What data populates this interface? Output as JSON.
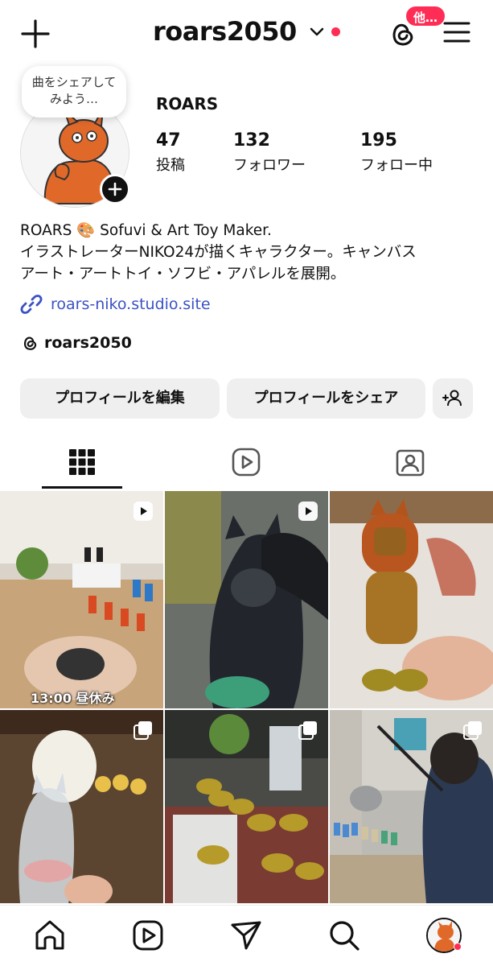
{
  "header": {
    "username": "roars2050",
    "threads_badge": "他…"
  },
  "profile": {
    "note": "曲をシェアしてみよう…",
    "display_name": "ROARS",
    "stats": [
      {
        "value": "47",
        "label": "投稿"
      },
      {
        "value": "132",
        "label": "フォロワー"
      },
      {
        "value": "195",
        "label": "フォロー中"
      }
    ],
    "bio_lines": [
      "ROARS 🎨 Sofuvi & Art Toy Maker.",
      "イラストレーターNIKO24が描くキャラクター。キャンバス",
      "アート・アートトイ・ソフビ・アパレルを展開。"
    ],
    "link": "roars-niko.studio.site",
    "threads_handle": "roars2050"
  },
  "buttons": {
    "edit": "プロフィールを編集",
    "share": "プロフィールをシェア"
  },
  "grid": {
    "items": [
      {
        "type": "reel",
        "caption": "13:00 昼休み"
      },
      {
        "type": "reel",
        "caption": ""
      },
      {
        "type": "photo",
        "caption": ""
      },
      {
        "type": "carousel",
        "caption": ""
      },
      {
        "type": "carousel",
        "caption": ""
      },
      {
        "type": "carousel",
        "caption": ""
      }
    ]
  },
  "colors": {
    "accent_red": "#ff2d55",
    "link_blue": "#3b52c4",
    "button_bg": "#efefef"
  }
}
